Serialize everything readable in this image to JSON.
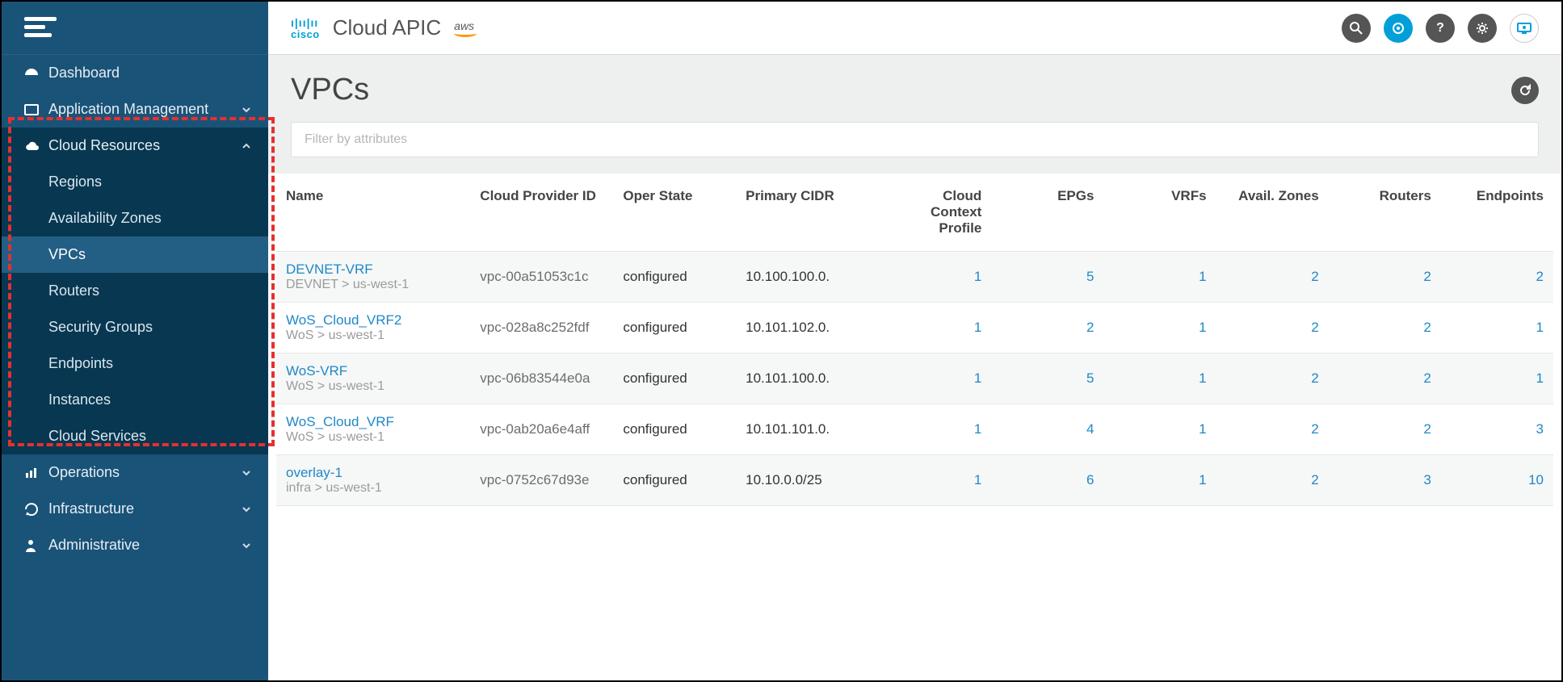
{
  "brand": {
    "logo_text": "cisco",
    "title": "Cloud APIC",
    "provider_tag": "aws"
  },
  "sidebar": {
    "items": [
      {
        "label": "Dashboard",
        "icon": "dashboard",
        "expandable": false
      },
      {
        "label": "Application Management",
        "icon": "app",
        "expandable": true,
        "expanded": false
      },
      {
        "label": "Cloud Resources",
        "icon": "cloud",
        "expandable": true,
        "expanded": true,
        "children": [
          {
            "label": "Regions"
          },
          {
            "label": "Availability Zones"
          },
          {
            "label": "VPCs",
            "active": true
          },
          {
            "label": "Routers"
          },
          {
            "label": "Security Groups"
          },
          {
            "label": "Endpoints"
          },
          {
            "label": "Instances"
          },
          {
            "label": "Cloud Services"
          }
        ]
      },
      {
        "label": "Operations",
        "icon": "operations",
        "expandable": true,
        "expanded": false
      },
      {
        "label": "Infrastructure",
        "icon": "infra",
        "expandable": true,
        "expanded": false
      },
      {
        "label": "Administrative",
        "icon": "admin",
        "expandable": true,
        "expanded": false
      }
    ]
  },
  "page": {
    "title": "VPCs",
    "filter_placeholder": "Filter by attributes"
  },
  "table": {
    "columns": [
      "Name",
      "Cloud Provider ID",
      "Oper State",
      "Primary CIDR",
      "Cloud Context Profile",
      "EPGs",
      "VRFs",
      "Avail. Zones",
      "Routers",
      "Endpoints"
    ],
    "rows": [
      {
        "name": "DEVNET-VRF",
        "name_sub": "DEVNET > us-west-1",
        "provider_id": "vpc-00a51053c1c",
        "oper_state": "configured",
        "primary_cidr": "10.100.100.0.",
        "cloud_ctx": "1",
        "epgs": "5",
        "vrfs": "1",
        "zones": "2",
        "routers": "2",
        "endpoints": "2"
      },
      {
        "name": "WoS_Cloud_VRF2",
        "name_sub": "WoS > us-west-1",
        "provider_id": "vpc-028a8c252fdf",
        "oper_state": "configured",
        "primary_cidr": "10.101.102.0.",
        "cloud_ctx": "1",
        "epgs": "2",
        "vrfs": "1",
        "zones": "2",
        "routers": "2",
        "endpoints": "1"
      },
      {
        "name": "WoS-VRF",
        "name_sub": "WoS > us-west-1",
        "provider_id": "vpc-06b83544e0a",
        "oper_state": "configured",
        "primary_cidr": "10.101.100.0.",
        "cloud_ctx": "1",
        "epgs": "5",
        "vrfs": "1",
        "zones": "2",
        "routers": "2",
        "endpoints": "1"
      },
      {
        "name": "WoS_Cloud_VRF",
        "name_sub": "WoS > us-west-1",
        "provider_id": "vpc-0ab20a6e4aff",
        "oper_state": "configured",
        "primary_cidr": "10.101.101.0.",
        "cloud_ctx": "1",
        "epgs": "4",
        "vrfs": "1",
        "zones": "2",
        "routers": "2",
        "endpoints": "3"
      },
      {
        "name": "overlay-1",
        "name_sub": "infra > us-west-1",
        "provider_id": "vpc-0752c67d93e",
        "oper_state": "configured",
        "primary_cidr": "10.10.0.0/25",
        "cloud_ctx": "1",
        "epgs": "6",
        "vrfs": "1",
        "zones": "2",
        "routers": "3",
        "endpoints": "10"
      }
    ]
  }
}
